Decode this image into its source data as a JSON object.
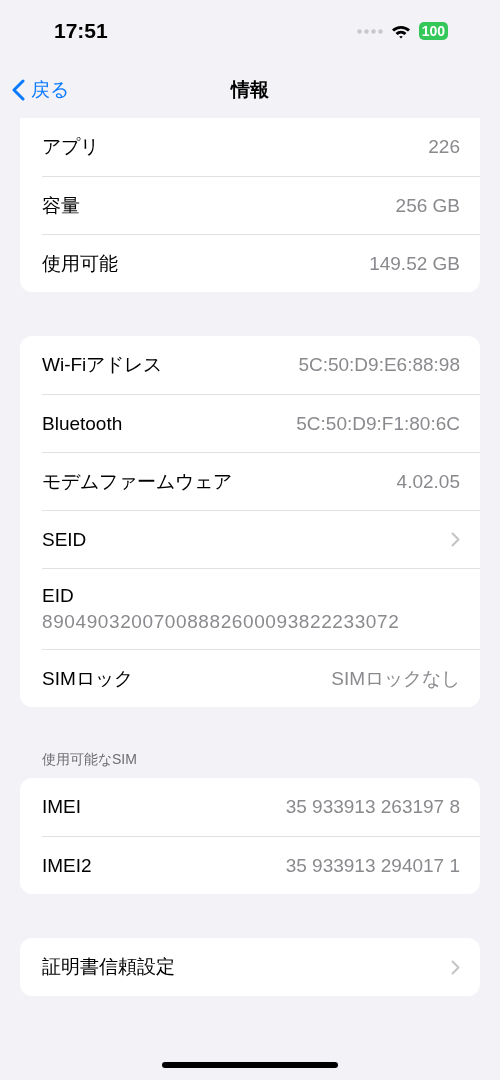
{
  "status_bar": {
    "time": "17:51",
    "battery": "100"
  },
  "nav": {
    "back": "戻る",
    "title": "情報"
  },
  "groups": [
    {
      "cut_top": true,
      "rows": [
        {
          "kind": "value",
          "label": "アプリ",
          "value": "226"
        },
        {
          "kind": "value",
          "label": "容量",
          "value": "256 GB"
        },
        {
          "kind": "value",
          "label": "使用可能",
          "value": "149.52 GB"
        }
      ]
    },
    {
      "cut_top": false,
      "rows": [
        {
          "kind": "value",
          "label": "Wi-Fiアドレス",
          "value": "5C:50:D9:E6:88:98"
        },
        {
          "kind": "value",
          "label": "Bluetooth",
          "value": "5C:50:D9:F1:80:6C"
        },
        {
          "kind": "value",
          "label": "モデムファームウェア",
          "value": "4.02.05"
        },
        {
          "kind": "chevron",
          "label": "SEID"
        },
        {
          "kind": "stacked",
          "label": "EID",
          "value": "89049032007008882600093822233072"
        },
        {
          "kind": "value",
          "label": "SIMロック",
          "value": "SIMロックなし"
        }
      ]
    },
    {
      "cut_top": false,
      "header": "使用可能なSIM",
      "rows": [
        {
          "kind": "value",
          "label": "IMEI",
          "value": "35 933913 263197 8"
        },
        {
          "kind": "value",
          "label": "IMEI2",
          "value": "35 933913 294017 1"
        }
      ]
    },
    {
      "cut_top": false,
      "rows": [
        {
          "kind": "chevron",
          "label": "証明書信頼設定"
        }
      ]
    }
  ]
}
